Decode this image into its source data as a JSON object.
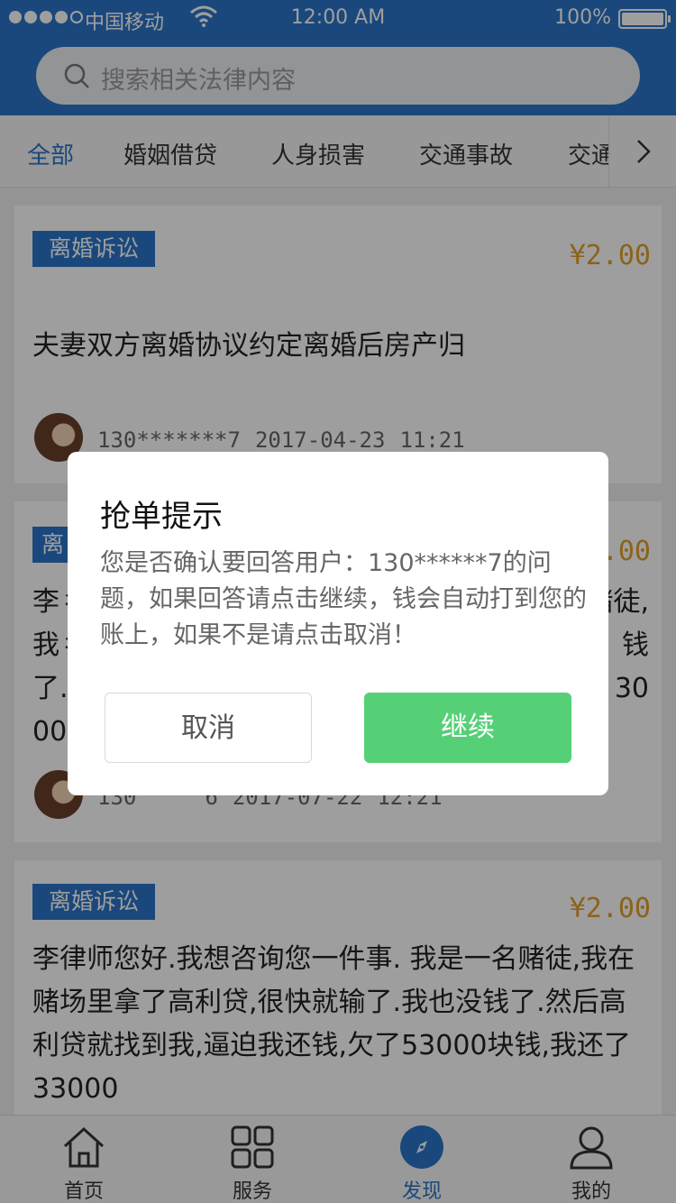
{
  "status_bar": {
    "carrier": "中国移动",
    "time": "12:00 AM",
    "battery": "100%"
  },
  "search": {
    "placeholder": "搜索相关法律内容",
    "icon": "search-icon"
  },
  "tabs": {
    "items": [
      {
        "label": "全部",
        "active": true
      },
      {
        "label": "婚姻借贷",
        "active": false
      },
      {
        "label": "人身损害",
        "active": false
      },
      {
        "label": "交通事故",
        "active": false
      },
      {
        "label": "交通",
        "active": false
      }
    ],
    "more_icon": "chevron-right-icon"
  },
  "cards": [
    {
      "tag": "离婚诉讼",
      "price": "¥2.00",
      "title": "夫妻双方离婚协议约定离婚后房产归",
      "user": "130*******7",
      "date": "2017-04-23",
      "time": "11:21"
    },
    {
      "tag": "离",
      "price": ".00",
      "title_lines": [
        "李彳",
        "我彳",
        "了.",
        "00"
      ],
      "title_right": [
        "赌徒,",
        "钱",
        "30"
      ],
      "user": "130",
      "user_tail": "6",
      "date": "2017-07-22",
      "time": "12:21"
    },
    {
      "tag": "离婚诉讼",
      "price": "¥2.00",
      "title": "李律师您好.我想咨询您一件事. 我是一名赌徒,我在赌场里拿了高利贷,很快就输了.我也没钱了.然后高利贷就找到我,逼迫我还钱,欠了53000块钱,我还了33000"
    }
  ],
  "dialog": {
    "title": "抢单提示",
    "message": "您是否确认要回答用户：130******7的问题，如果回答请点击继续，钱会自动打到您的账上，如果不是请点击取消！",
    "cancel_label": "取消",
    "confirm_label": "继续"
  },
  "nav": {
    "items": [
      {
        "label": "首页",
        "icon": "home-icon",
        "active": false
      },
      {
        "label": "服务",
        "icon": "grid-icon",
        "active": false
      },
      {
        "label": "发现",
        "icon": "compass-icon",
        "active": true
      },
      {
        "label": "我的",
        "icon": "user-icon",
        "active": false
      }
    ]
  },
  "colors": {
    "brand_blue": "#2a74c8",
    "price_orange": "#e0a12a",
    "confirm_green": "#55d077"
  }
}
